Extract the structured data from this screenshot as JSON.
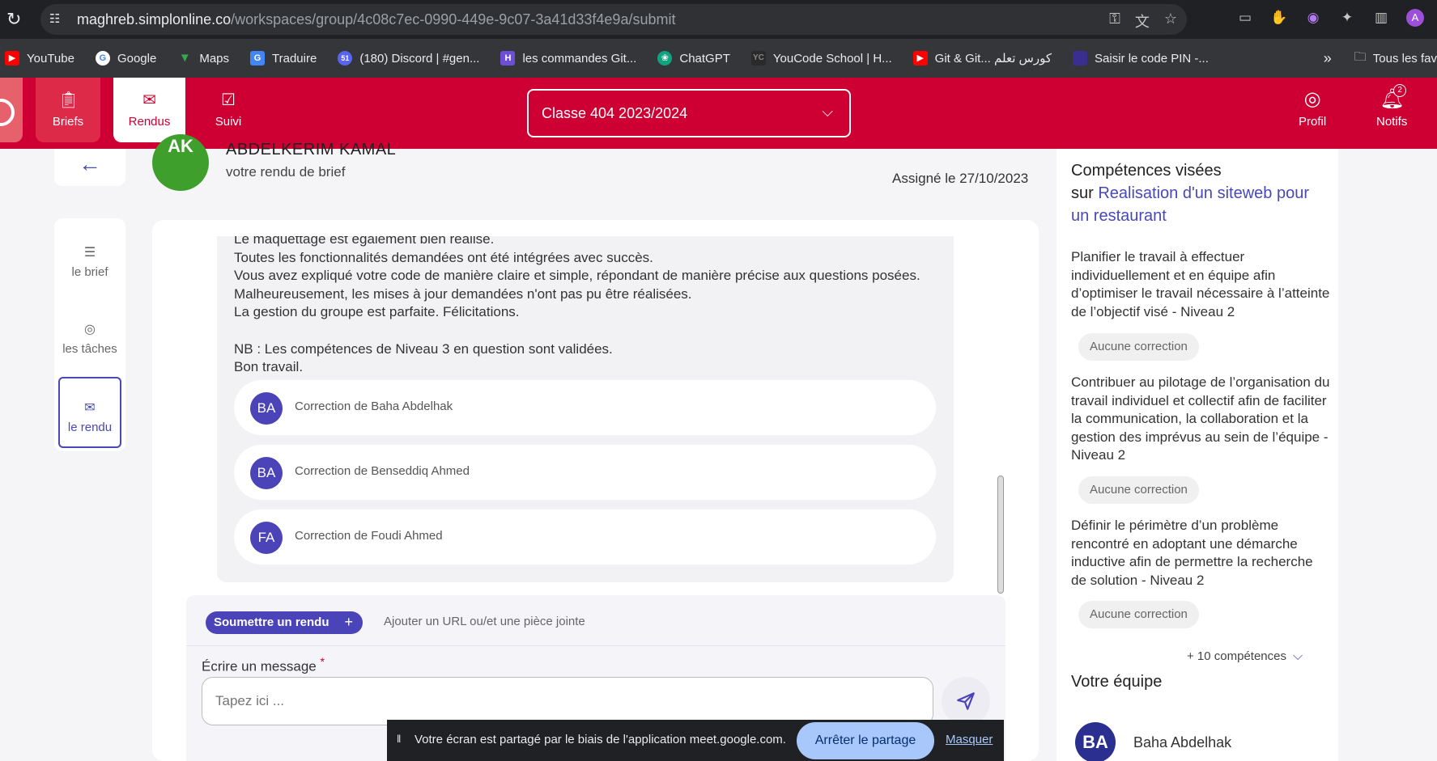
{
  "browser": {
    "url_domain": "maghreb.simplonline.co",
    "url_path": "/workspaces/group/4c08c7ec-0990-449e-9c07-3a41d33f4e9a/submit",
    "profile_initial": "A",
    "bookmarks": [
      {
        "label": "YouTube",
        "icon": "youtube-icon",
        "color": "#ff0000"
      },
      {
        "label": "Google",
        "icon": "google-icon",
        "color": "#4285f4"
      },
      {
        "label": "Maps",
        "icon": "maps-icon",
        "color": "#34a853"
      },
      {
        "label": "Traduire",
        "icon": "translate-icon",
        "color": "#4285f4"
      },
      {
        "label": "(180) Discord | #gen...",
        "icon": "discord-icon",
        "color": "#5865f2",
        "badge": "51"
      },
      {
        "label": "les commandes Git...",
        "icon": "git-doc-icon",
        "color": "#6b4fd8"
      },
      {
        "label": "ChatGPT",
        "icon": "chatgpt-icon",
        "color": "#10a37f"
      },
      {
        "label": "YouCode School | H...",
        "icon": "youcode-icon",
        "color": "#444444"
      },
      {
        "label": "Git & Git... كورس تعلم",
        "icon": "youtube-icon",
        "color": "#ff0000"
      },
      {
        "label": "Saisir le code PIN -...",
        "icon": "pin-icon",
        "color": "#3a2f8f"
      }
    ],
    "bookmarks_more": "»",
    "all_bookmarks": "Tous les fav"
  },
  "header": {
    "nav": [
      {
        "label": "Briefs",
        "icon": "clipboard-icon"
      },
      {
        "label": "Rendus",
        "icon": "inbox-icon"
      },
      {
        "label": "Suivi",
        "icon": "checklist-icon"
      }
    ],
    "class_select": "Classe 404 2023/2024",
    "profile_label": "Profil",
    "notifs_label": "Notifs",
    "notifs_count": "2"
  },
  "sidebar": {
    "items": [
      {
        "label": "le brief",
        "icon": "clipboard-icon"
      },
      {
        "label": "les tâches",
        "icon": "user-circle-icon"
      },
      {
        "label": "le rendu",
        "icon": "inbox-icon"
      }
    ]
  },
  "submission": {
    "avatar_initials": "AK",
    "name": "ABDELKERIM KAMAL",
    "subtitle": "votre rendu de brief",
    "assigned": "Assigné le 27/10/2023",
    "feedback_lines": [
      "Le maquettage est également bien réalisé.",
      "Toutes les fonctionnalités demandées ont été intégrées avec succès.",
      "Vous avez expliqué votre code de manière claire et simple, répondant de manière précise aux questions posées.",
      "Malheureusement, les mises à jour demandées n'ont pas pu être réalisées.",
      "La gestion du groupe est parfaite. Félicitations.",
      "",
      "NB : Les compétences de Niveau 3 en question sont validées.",
      "Bon travail."
    ],
    "corrections": [
      {
        "initials": "BA",
        "label": "Correction de Baha Abdelhak"
      },
      {
        "initials": "BA",
        "label": "Correction de Benseddiq Ahmed"
      },
      {
        "initials": "FA",
        "label": "Correction de Foudi Ahmed"
      }
    ],
    "submit_button": "Soumettre un rendu",
    "attach_label": "Ajouter un URL ou/et une pièce jointe",
    "message_label": "Écrire un message",
    "message_placeholder": "Tapez ici ..."
  },
  "right_panel": {
    "title": "Compétences visées",
    "title_prefix": "sur",
    "brief_link": "Realisation d'un siteweb pour un restaurant",
    "competences": [
      {
        "text": "Planifier le travail à effectuer individuellement et en équipe afin d’optimiser le travail nécessaire à l’atteinte de l’objectif visé - Niveau 2",
        "status": "Aucune correction"
      },
      {
        "text": "Contribuer au pilotage de l’organisation du travail individuel et collectif afin de faciliter la communication, la collaboration et la gestion des imprévus au sein de l’équipe - Niveau 2",
        "status": "Aucune correction"
      },
      {
        "text": "Définir le périmètre d’un problème rencontré en adoptant une démarche inductive afin de permettre la recherche de solution - Niveau 2",
        "status": "Aucune correction"
      }
    ],
    "more_label": "+ 10 compétences",
    "team_title": "Votre équipe",
    "team": [
      {
        "initials": "BA",
        "name": "Baha Abdelhak"
      }
    ]
  },
  "screen_share": {
    "pause_icon": "pause-icon",
    "text": "Votre écran est partagé par le biais de l'application meet.google.com.",
    "stop_button": "Arrêter le partage",
    "hide_link": "Masquer"
  },
  "colors": {
    "brand_red": "#ce0033",
    "accent_purple": "#4b44b8",
    "avatar_green": "#3f9f2c"
  }
}
